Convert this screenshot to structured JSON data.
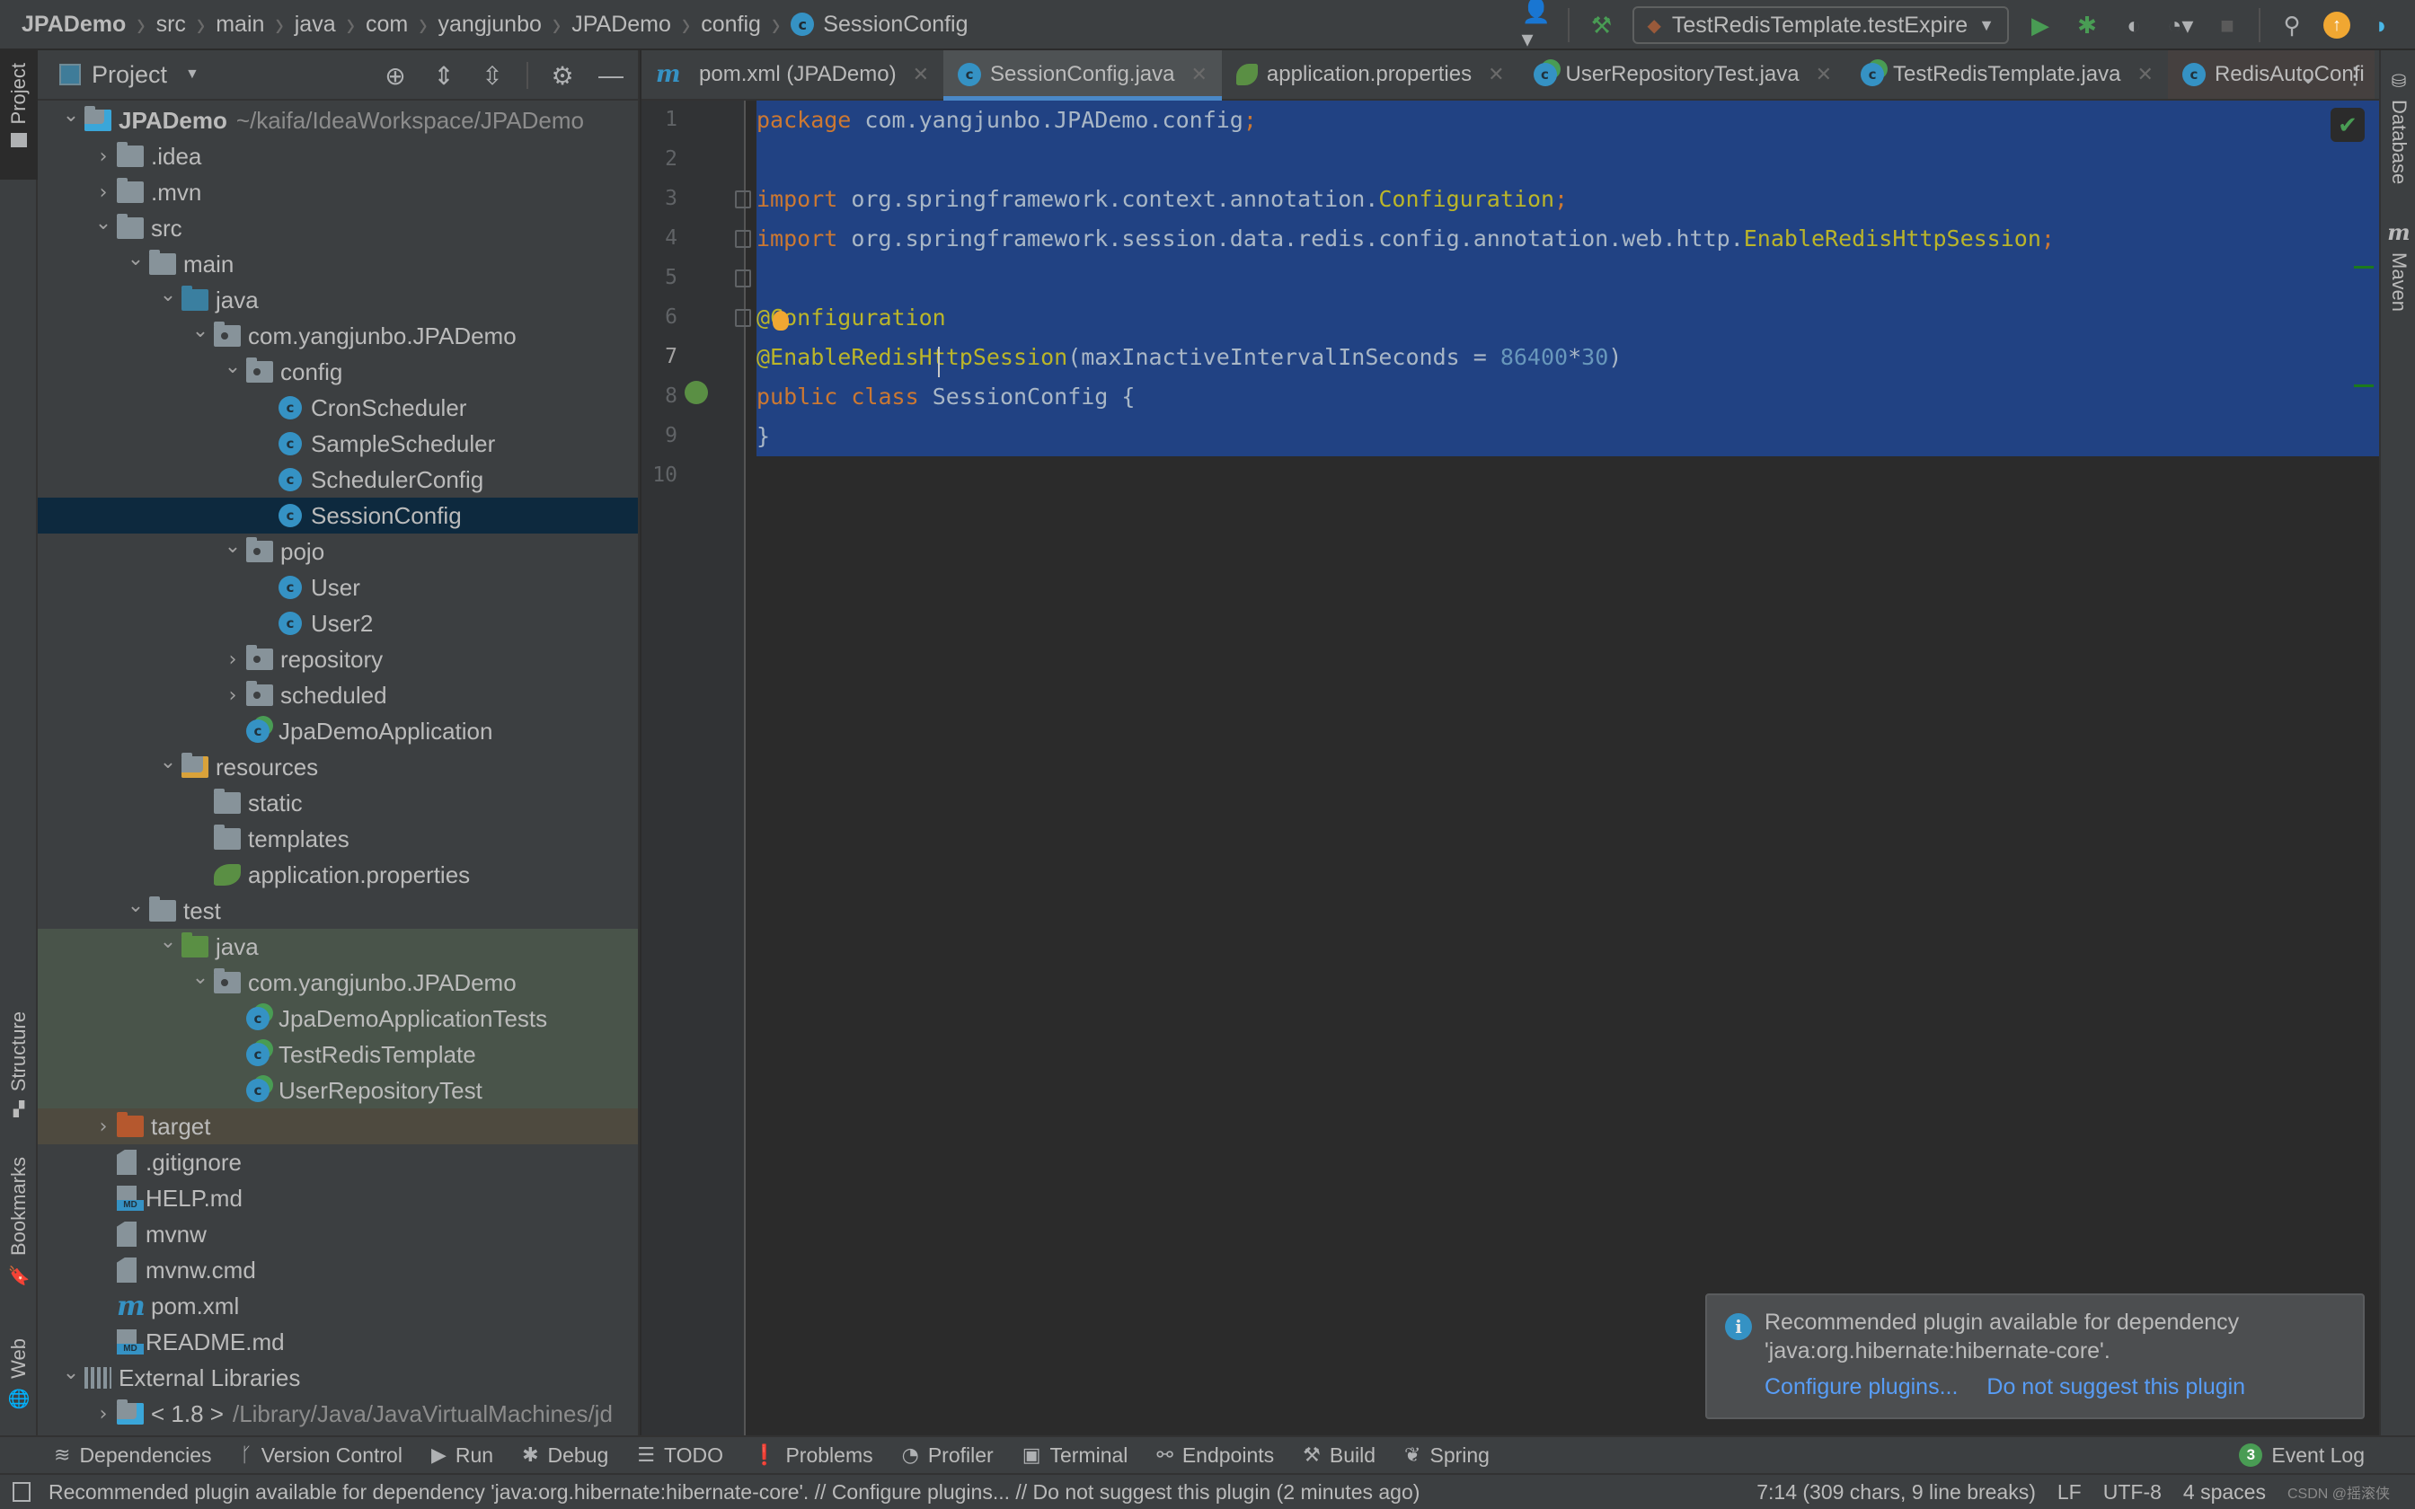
{
  "breadcrumbs": [
    "JPADemo",
    "src",
    "main",
    "java",
    "com",
    "yangjunbo",
    "JPADemo",
    "config",
    "SessionConfig"
  ],
  "toolbar": {
    "run_config": "TestRedisTemplate.testExpire",
    "icons": [
      "user-icon",
      "build-hammer-icon",
      "run-icon",
      "debug-icon",
      "coverage-icon",
      "profiler-icon",
      "stop-icon",
      "search-icon",
      "update-icon",
      "toolbox-icon"
    ]
  },
  "left_strip": {
    "project": "Project",
    "structure": "Structure",
    "bookmarks": "Bookmarks",
    "web": "Web"
  },
  "right_strip": {
    "database": "Database",
    "maven": "Maven"
  },
  "project_panel": {
    "title": "Project",
    "tree": [
      {
        "label": "JPADemo",
        "extra": "~/kaifa/IdeaWorkspace/JPADemo",
        "depth": 0,
        "arrow": "open",
        "icon": "module"
      },
      {
        "label": ".idea",
        "depth": 1,
        "arrow": "closed",
        "icon": "folder"
      },
      {
        "label": ".mvn",
        "depth": 1,
        "arrow": "closed",
        "icon": "folder"
      },
      {
        "label": "src",
        "depth": 1,
        "arrow": "open",
        "icon": "folder"
      },
      {
        "label": "main",
        "depth": 2,
        "arrow": "open",
        "icon": "folder"
      },
      {
        "label": "java",
        "depth": 3,
        "arrow": "open",
        "icon": "folder-blue"
      },
      {
        "label": "com.yangjunbo.JPADemo",
        "depth": 4,
        "arrow": "open",
        "icon": "package"
      },
      {
        "label": "config",
        "depth": 5,
        "arrow": "open",
        "icon": "package"
      },
      {
        "label": "CronScheduler",
        "depth": 6,
        "arrow": "none",
        "icon": "class"
      },
      {
        "label": "SampleScheduler",
        "depth": 6,
        "arrow": "none",
        "icon": "class"
      },
      {
        "label": "SchedulerConfig",
        "depth": 6,
        "arrow": "none",
        "icon": "class"
      },
      {
        "label": "SessionConfig",
        "depth": 6,
        "arrow": "none",
        "icon": "class",
        "selected": true
      },
      {
        "label": "pojo",
        "depth": 5,
        "arrow": "open",
        "icon": "package"
      },
      {
        "label": "User",
        "depth": 6,
        "arrow": "none",
        "icon": "class"
      },
      {
        "label": "User2",
        "depth": 6,
        "arrow": "none",
        "icon": "class"
      },
      {
        "label": "repository",
        "depth": 5,
        "arrow": "closed",
        "icon": "package"
      },
      {
        "label": "scheduled",
        "depth": 5,
        "arrow": "closed",
        "icon": "package"
      },
      {
        "label": "JpaDemoApplication",
        "depth": 5,
        "arrow": "none",
        "icon": "spring-class"
      },
      {
        "label": "resources",
        "depth": 3,
        "arrow": "open",
        "icon": "resources"
      },
      {
        "label": "static",
        "depth": 4,
        "arrow": "none",
        "icon": "folder"
      },
      {
        "label": "templates",
        "depth": 4,
        "arrow": "none",
        "icon": "folder"
      },
      {
        "label": "application.properties",
        "depth": 4,
        "arrow": "none",
        "icon": "spring-properties"
      },
      {
        "label": "test",
        "depth": 2,
        "arrow": "open",
        "icon": "folder"
      },
      {
        "label": "java",
        "depth": 3,
        "arrow": "open",
        "icon": "folder-green",
        "test": true
      },
      {
        "label": "com.yangjunbo.JPADemo",
        "depth": 4,
        "arrow": "open",
        "icon": "package",
        "test": true
      },
      {
        "label": "JpaDemoApplicationTests",
        "depth": 5,
        "arrow": "none",
        "icon": "test-class",
        "test": true
      },
      {
        "label": "TestRedisTemplate",
        "depth": 5,
        "arrow": "none",
        "icon": "test-class",
        "test": true
      },
      {
        "label": "UserRepositoryTest",
        "depth": 5,
        "arrow": "none",
        "icon": "test-class",
        "test": true
      },
      {
        "label": "target",
        "depth": 1,
        "arrow": "closed",
        "icon": "folder-orange",
        "excluded": true
      },
      {
        "label": ".gitignore",
        "depth": 1,
        "arrow": "none",
        "icon": "gitignore"
      },
      {
        "label": "HELP.md",
        "depth": 1,
        "arrow": "none",
        "icon": "markdown"
      },
      {
        "label": "mvnw",
        "depth": 1,
        "arrow": "none",
        "icon": "shell"
      },
      {
        "label": "mvnw.cmd",
        "depth": 1,
        "arrow": "none",
        "icon": "text-file"
      },
      {
        "label": "pom.xml",
        "depth": 1,
        "arrow": "none",
        "icon": "maven"
      },
      {
        "label": "README.md",
        "depth": 1,
        "arrow": "none",
        "icon": "markdown"
      },
      {
        "label": "External Libraries",
        "depth": 0,
        "arrow": "open",
        "icon": "libraries"
      },
      {
        "label": "< 1.8 >",
        "extra": "/Library/Java/JavaVirtualMachines/jd",
        "depth": 1,
        "arrow": "closed",
        "icon": "jdk"
      }
    ]
  },
  "tabs": [
    {
      "label": "pom.xml (JPADemo)",
      "icon": "maven-icon",
      "active": false
    },
    {
      "label": "SessionConfig.java",
      "icon": "class-icon",
      "active": true
    },
    {
      "label": "application.properties",
      "icon": "spring-properties-icon",
      "active": false
    },
    {
      "label": "UserRepositoryTest.java",
      "icon": "test-class-icon",
      "active": false
    },
    {
      "label": "TestRedisTemplate.java",
      "icon": "test-class-icon",
      "active": false
    },
    {
      "label": "RedisAutoConfi",
      "icon": "locked-class-icon",
      "active": false,
      "pinned": true
    }
  ],
  "editor": {
    "current_line": 7,
    "line_numbers": [
      "1",
      "2",
      "3",
      "4",
      "5",
      "6",
      "7",
      "8",
      "9",
      "10"
    ],
    "lines": [
      [
        {
          "t": "package",
          "c": "kw"
        },
        {
          "t": " com.yangjunbo.JPADemo.config"
        },
        {
          "t": ";",
          "c": "kw"
        }
      ],
      [],
      [
        {
          "t": "import",
          "c": "kw"
        },
        {
          "t": " org.springframework.context.annotation."
        },
        {
          "t": "Configuration",
          "c": "ann"
        },
        {
          "t": ";",
          "c": "kw"
        }
      ],
      [
        {
          "t": "import",
          "c": "kw"
        },
        {
          "t": " org.springframework.session.data.redis.config.annotation.web.http."
        },
        {
          "t": "EnableRedisHttpSession",
          "c": "ann"
        },
        {
          "t": ";",
          "c": "kw"
        }
      ],
      [],
      [
        {
          "t": "@Configuration",
          "c": "ann"
        }
      ],
      [
        {
          "t": "@EnableRedisHttpSession",
          "c": "ann"
        },
        {
          "t": "(maxInactiveIntervalInSeconds = "
        },
        {
          "t": "86400",
          "c": "num"
        },
        {
          "t": "*"
        },
        {
          "t": "30",
          "c": "num"
        },
        {
          "t": ")"
        }
      ],
      [
        {
          "t": "public",
          "c": "kw"
        },
        {
          "t": " "
        },
        {
          "t": "class",
          "c": "kw"
        },
        {
          "t": " SessionConfig {"
        }
      ],
      [
        {
          "t": "}"
        }
      ],
      []
    ]
  },
  "notification": {
    "message": "Recommended plugin available for dependency 'java:org.hibernate:hibernate-core'.",
    "actions": [
      "Configure plugins...",
      "Do not suggest this plugin"
    ]
  },
  "bottom_tools": [
    {
      "label": "Dependencies",
      "icon": "dependencies-icon",
      "glyph": "≋"
    },
    {
      "label": "Version Control",
      "icon": "vcs-icon",
      "glyph": "ᚴ"
    },
    {
      "label": "Run",
      "icon": "run-icon",
      "glyph": "▶"
    },
    {
      "label": "Debug",
      "icon": "debug-icon",
      "glyph": "✱"
    },
    {
      "label": "TODO",
      "icon": "todo-icon",
      "glyph": "☰"
    },
    {
      "label": "Problems",
      "icon": "problems-icon",
      "glyph": "❗"
    },
    {
      "label": "Profiler",
      "icon": "profiler-icon",
      "glyph": "◔"
    },
    {
      "label": "Terminal",
      "icon": "terminal-icon",
      "glyph": "▣"
    },
    {
      "label": "Endpoints",
      "icon": "endpoints-icon",
      "glyph": "⚯"
    },
    {
      "label": "Build",
      "icon": "build-icon",
      "glyph": "⚒"
    },
    {
      "label": "Spring",
      "icon": "spring-icon",
      "glyph": "❦"
    }
  ],
  "event_log": {
    "label": "Event Log",
    "count": "3"
  },
  "status": {
    "message": "Recommended plugin available for dependency 'java:org.hibernate:hibernate-core'. // Configure plugins... // Do not suggest this plugin (2 minutes ago)",
    "position": "7:14 (309 chars, 9 line breaks)",
    "line_sep": "LF",
    "encoding": "UTF-8",
    "indent": "4 spaces",
    "watermark": "CSDN @摇滚侠"
  }
}
